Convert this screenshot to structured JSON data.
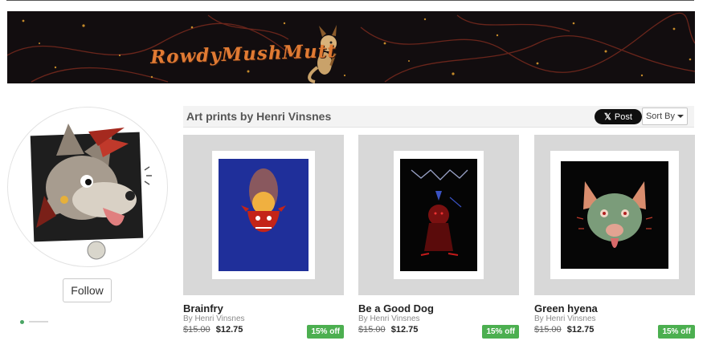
{
  "banner": {
    "title": "RowdyMushMutt",
    "background": "#120d0f",
    "accent": "#e07a33"
  },
  "profile": {
    "avatar_icon": "hyena-dog-avatar-icon",
    "follow_label": "Follow"
  },
  "shop": {
    "title": "Art prints by Henri Vinsnes",
    "post_label": "Post",
    "post_icon": "x-logo-icon",
    "sort_label": "Sort By",
    "discount_color": "#4caf50"
  },
  "products": [
    {
      "name": "Brainfry",
      "artist": "By Henri Vinsnes",
      "old_price": "$15.00",
      "new_price": "$12.75",
      "discount": "15% off"
    },
    {
      "name": "Be a Good Dog",
      "artist": "By Henri Vinsnes",
      "old_price": "$15.00",
      "new_price": "$12.75",
      "discount": "15% off"
    },
    {
      "name": "Green hyena",
      "artist": "By Henri Vinsnes",
      "old_price": "$15.00",
      "new_price": "$12.75",
      "discount": "15% off"
    }
  ]
}
